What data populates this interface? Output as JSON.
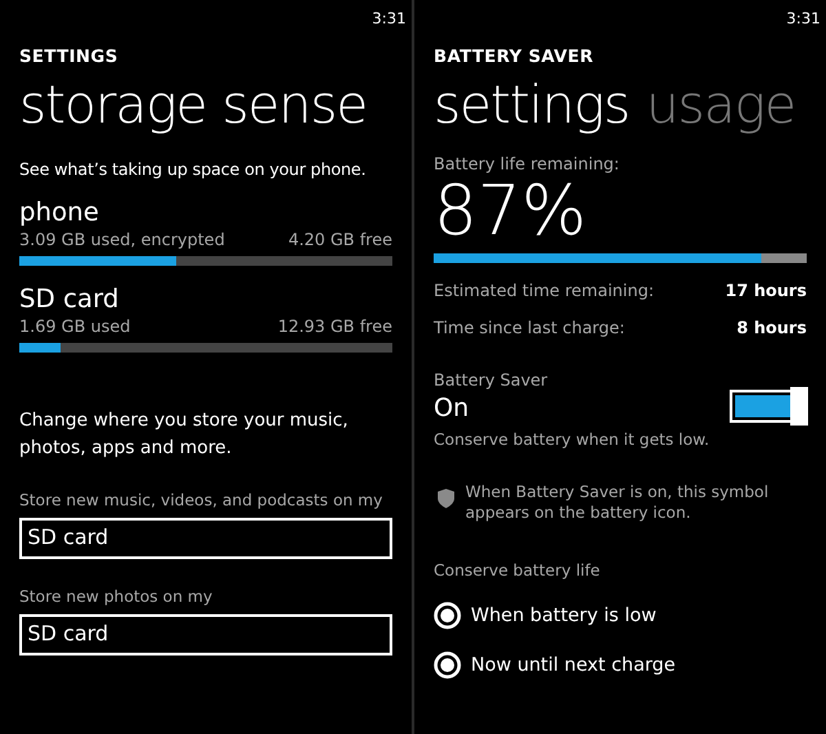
{
  "storage_screen": {
    "clock": "3:31",
    "app_title": "SETTINGS",
    "page_title": "storage sense",
    "intro": "See what’s taking up space on your phone.",
    "locations": [
      {
        "name": "phone",
        "used": "3.09 GB used, encrypted",
        "free": "4.20 GB free",
        "level": 0.42
      },
      {
        "name": "SD card",
        "used": "1.69 GB used",
        "free": "12.93 GB free",
        "level": 0.11
      }
    ],
    "change_text": "Change where you store your music, photos, apps and more.",
    "pickers": [
      {
        "label": "Store new music, videos, and podcasts on my",
        "value": "SD card"
      },
      {
        "label": "Store new photos on my",
        "value": "SD card"
      }
    ]
  },
  "battery_screen": {
    "clock": "3:31",
    "app_title": "BATTERY SAVER",
    "pivots": [
      {
        "label": "settings",
        "selected": true
      },
      {
        "label": "usage",
        "selected": false
      }
    ],
    "life_label": "Battery life remaining:",
    "life_value": "87%",
    "level": 0.88,
    "stats": [
      {
        "label": "Estimated time remaining:",
        "value": "17 hours"
      },
      {
        "label": "Time since last charge:",
        "value": "8 hours"
      }
    ],
    "saver": {
      "label": "Battery Saver",
      "state_text": "On",
      "on": true,
      "description": "Conserve battery when it gets low."
    },
    "note": "When Battery Saver is on, this symbol appears on the battery icon.",
    "conserve_label": "Conserve battery life",
    "options": [
      {
        "label": "When battery is low",
        "selected": true
      },
      {
        "label": "Now until next charge",
        "selected": true
      }
    ]
  }
}
